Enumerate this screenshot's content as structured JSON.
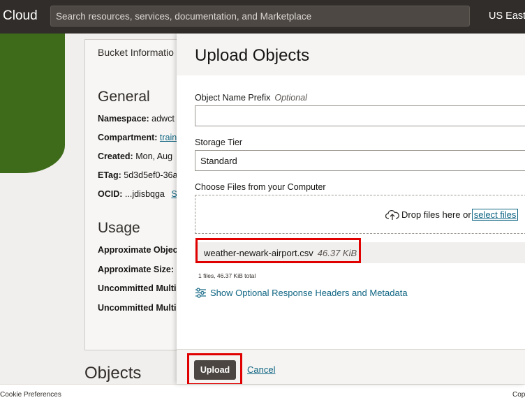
{
  "topbar": {
    "brand": "Cloud",
    "search_placeholder": "Search resources, services, documentation, and Marketplace",
    "region": "US East"
  },
  "background": {
    "card_tab": "Bucket Informatio",
    "general_title": "General",
    "fields": [
      {
        "label": "Namespace:",
        "value": "adwct"
      },
      {
        "label": "Compartment:",
        "value": "train"
      },
      {
        "label": "Created:",
        "value": "Mon, Aug"
      },
      {
        "label": "ETag:",
        "value": "5d3d5ef0-36a"
      },
      {
        "label": "OCID:",
        "value": "...jdisbqga",
        "extra": "S"
      }
    ],
    "usage_title": "Usage",
    "usage_fields": [
      "Approximate Objec",
      "Approximate Size:",
      "Uncommitted Multi",
      "Uncommitted Multi"
    ],
    "objects_title": "Objects"
  },
  "footer": {
    "left": "Cookie Preferences",
    "right": "Cop"
  },
  "drawer": {
    "title": "Upload Objects",
    "prefix_label": "Object Name Prefix",
    "prefix_optional": "Optional",
    "prefix_value": "",
    "tier_label": "Storage Tier",
    "tier_value": "Standard",
    "files_label": "Choose Files from your Computer",
    "drop_text": "Drop files here or",
    "select_files": "select files",
    "file": {
      "name": "weather-newark-airport.csv",
      "size": "46.37 KiB"
    },
    "summary": "1 files, 46.37 KiB total",
    "optional_link": "Show Optional Response Headers and Metadata",
    "upload_label": "Upload",
    "cancel_label": "Cancel"
  },
  "colors": {
    "topbar": "#312d2a",
    "link": "#0f6583",
    "highlight": "#e00000",
    "button": "#4b4641",
    "logo_green": "#3d6b1a"
  }
}
